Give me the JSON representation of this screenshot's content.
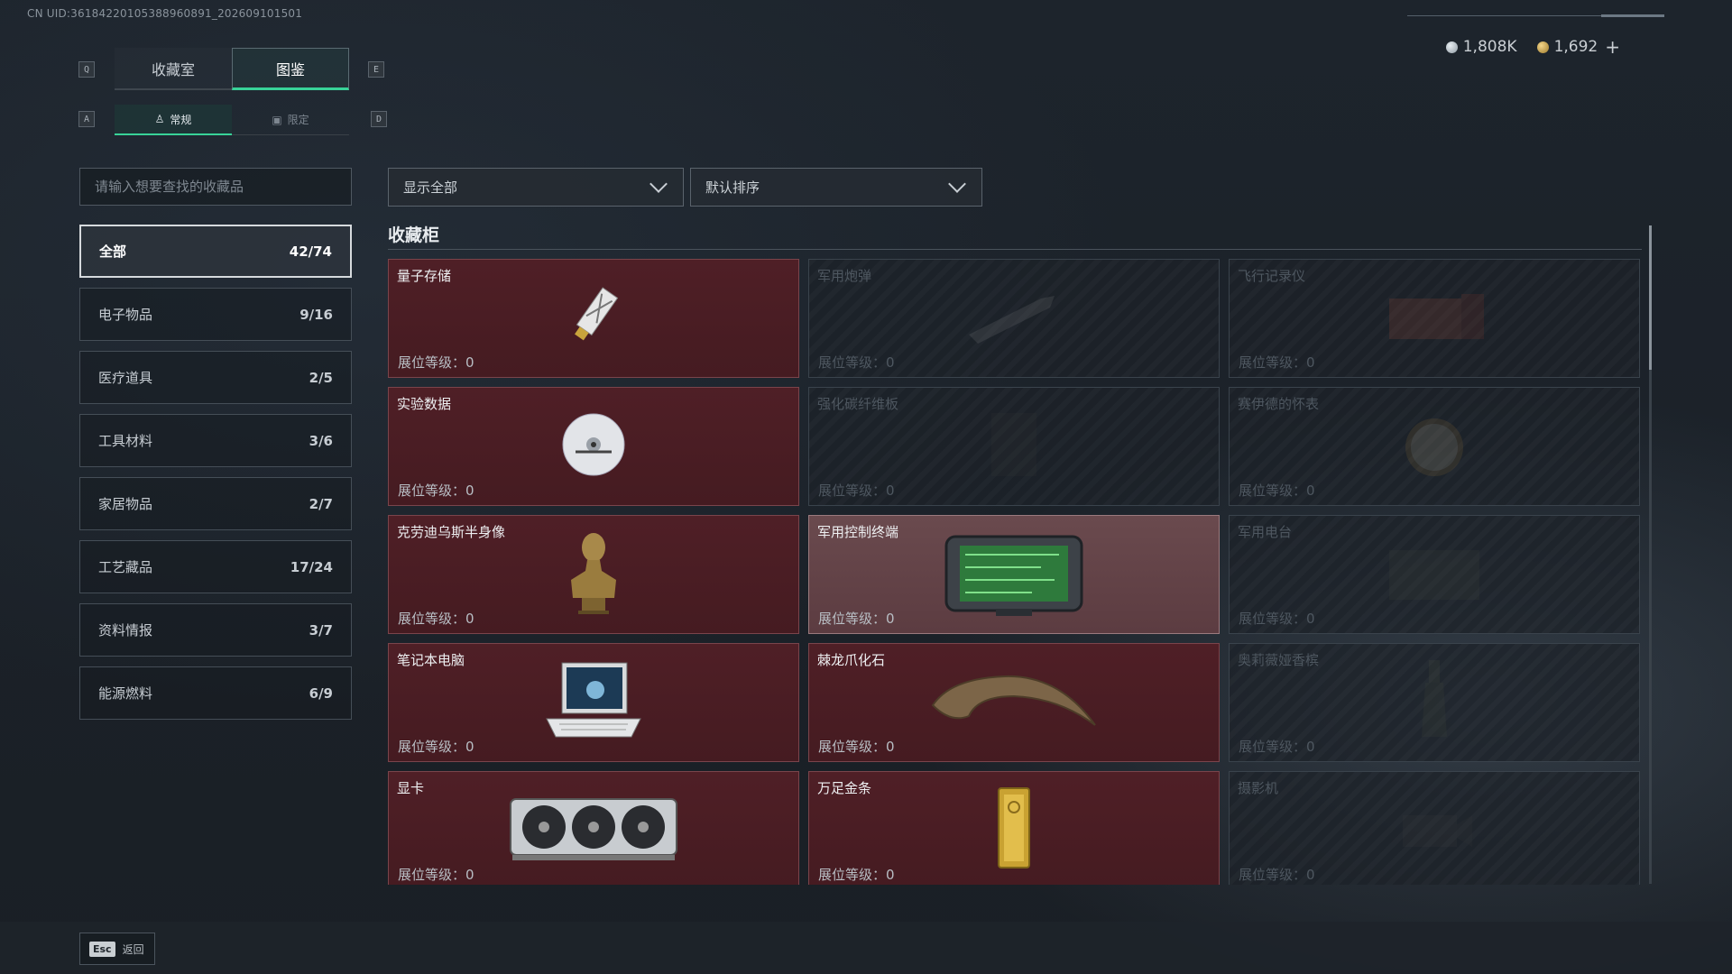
{
  "uid_text": "CN UID:3618422010538896089​1_202609101501",
  "currency": {
    "silver": "1,808K",
    "gold": "1,692",
    "plus": "+",
    "silver_icon": "silver-coin-icon",
    "gold_icon": "gold-coin-icon"
  },
  "keys": {
    "q": "Q",
    "e": "E",
    "a": "A",
    "d": "D"
  },
  "tabs_main": [
    {
      "label": "收藏室",
      "active": false
    },
    {
      "label": "图鉴",
      "active": true
    }
  ],
  "tabs_sub": [
    {
      "label": "常规",
      "active": true
    },
    {
      "label": "限定",
      "active": false
    }
  ],
  "search": {
    "placeholder": "请输入想要查找的收藏品",
    "value": ""
  },
  "filters": {
    "show": "显示全部",
    "sort": "默认排序"
  },
  "categories": [
    {
      "label": "全部",
      "count": "42/74",
      "active": true
    },
    {
      "label": "电子物品",
      "count": "9/16"
    },
    {
      "label": "医疗道具",
      "count": "2/5"
    },
    {
      "label": "工具材料",
      "count": "3/6"
    },
    {
      "label": "家居物品",
      "count": "2/7"
    },
    {
      "label": "工艺藏品",
      "count": "17/24"
    },
    {
      "label": "资料情报",
      "count": "3/7"
    },
    {
      "label": "能源燃料",
      "count": "6/9"
    }
  ],
  "section_title": "收藏柜",
  "level_label": "展位等级：",
  "cards": [
    {
      "name": "量子存储",
      "level": "0",
      "state": "owned",
      "icon": "usb-stick-icon"
    },
    {
      "name": "军用炮弹",
      "level": "0",
      "state": "locked",
      "icon": "shell-icon"
    },
    {
      "name": "飞行记录仪",
      "level": "0",
      "state": "locked",
      "icon": "flight-recorder-icon"
    },
    {
      "name": "实验数据",
      "level": "0",
      "state": "owned",
      "icon": "disc-icon"
    },
    {
      "name": "强化碳纤维板",
      "level": "0",
      "state": "locked",
      "icon": "carbon-plate-icon"
    },
    {
      "name": "赛伊德的怀表",
      "level": "0",
      "state": "locked",
      "icon": "pocket-watch-icon"
    },
    {
      "name": "克劳迪乌斯半身像",
      "level": "0",
      "state": "owned",
      "icon": "bust-icon"
    },
    {
      "name": "军用控制终端",
      "level": "0",
      "state": "selected",
      "icon": "control-terminal-icon"
    },
    {
      "name": "军用电台",
      "level": "0",
      "state": "locked",
      "icon": "radio-icon"
    },
    {
      "name": "笔记本电脑",
      "level": "0",
      "state": "owned",
      "icon": "laptop-icon"
    },
    {
      "name": "棘龙爪化石",
      "level": "0",
      "state": "owned",
      "icon": "claw-fossil-icon"
    },
    {
      "name": "奥莉薇娅香槟",
      "level": "0",
      "state": "locked",
      "icon": "champagne-icon"
    },
    {
      "name": "显卡",
      "level": "0",
      "state": "owned",
      "icon": "graphics-card-icon"
    },
    {
      "name": "万足金条",
      "level": "0",
      "state": "owned",
      "icon": "gold-bar-icon"
    },
    {
      "name": "摄影机",
      "level": "0",
      "state": "locked",
      "icon": "camera-icon"
    }
  ],
  "footer": {
    "esc_key": "Esc",
    "esc_label": "返回"
  }
}
